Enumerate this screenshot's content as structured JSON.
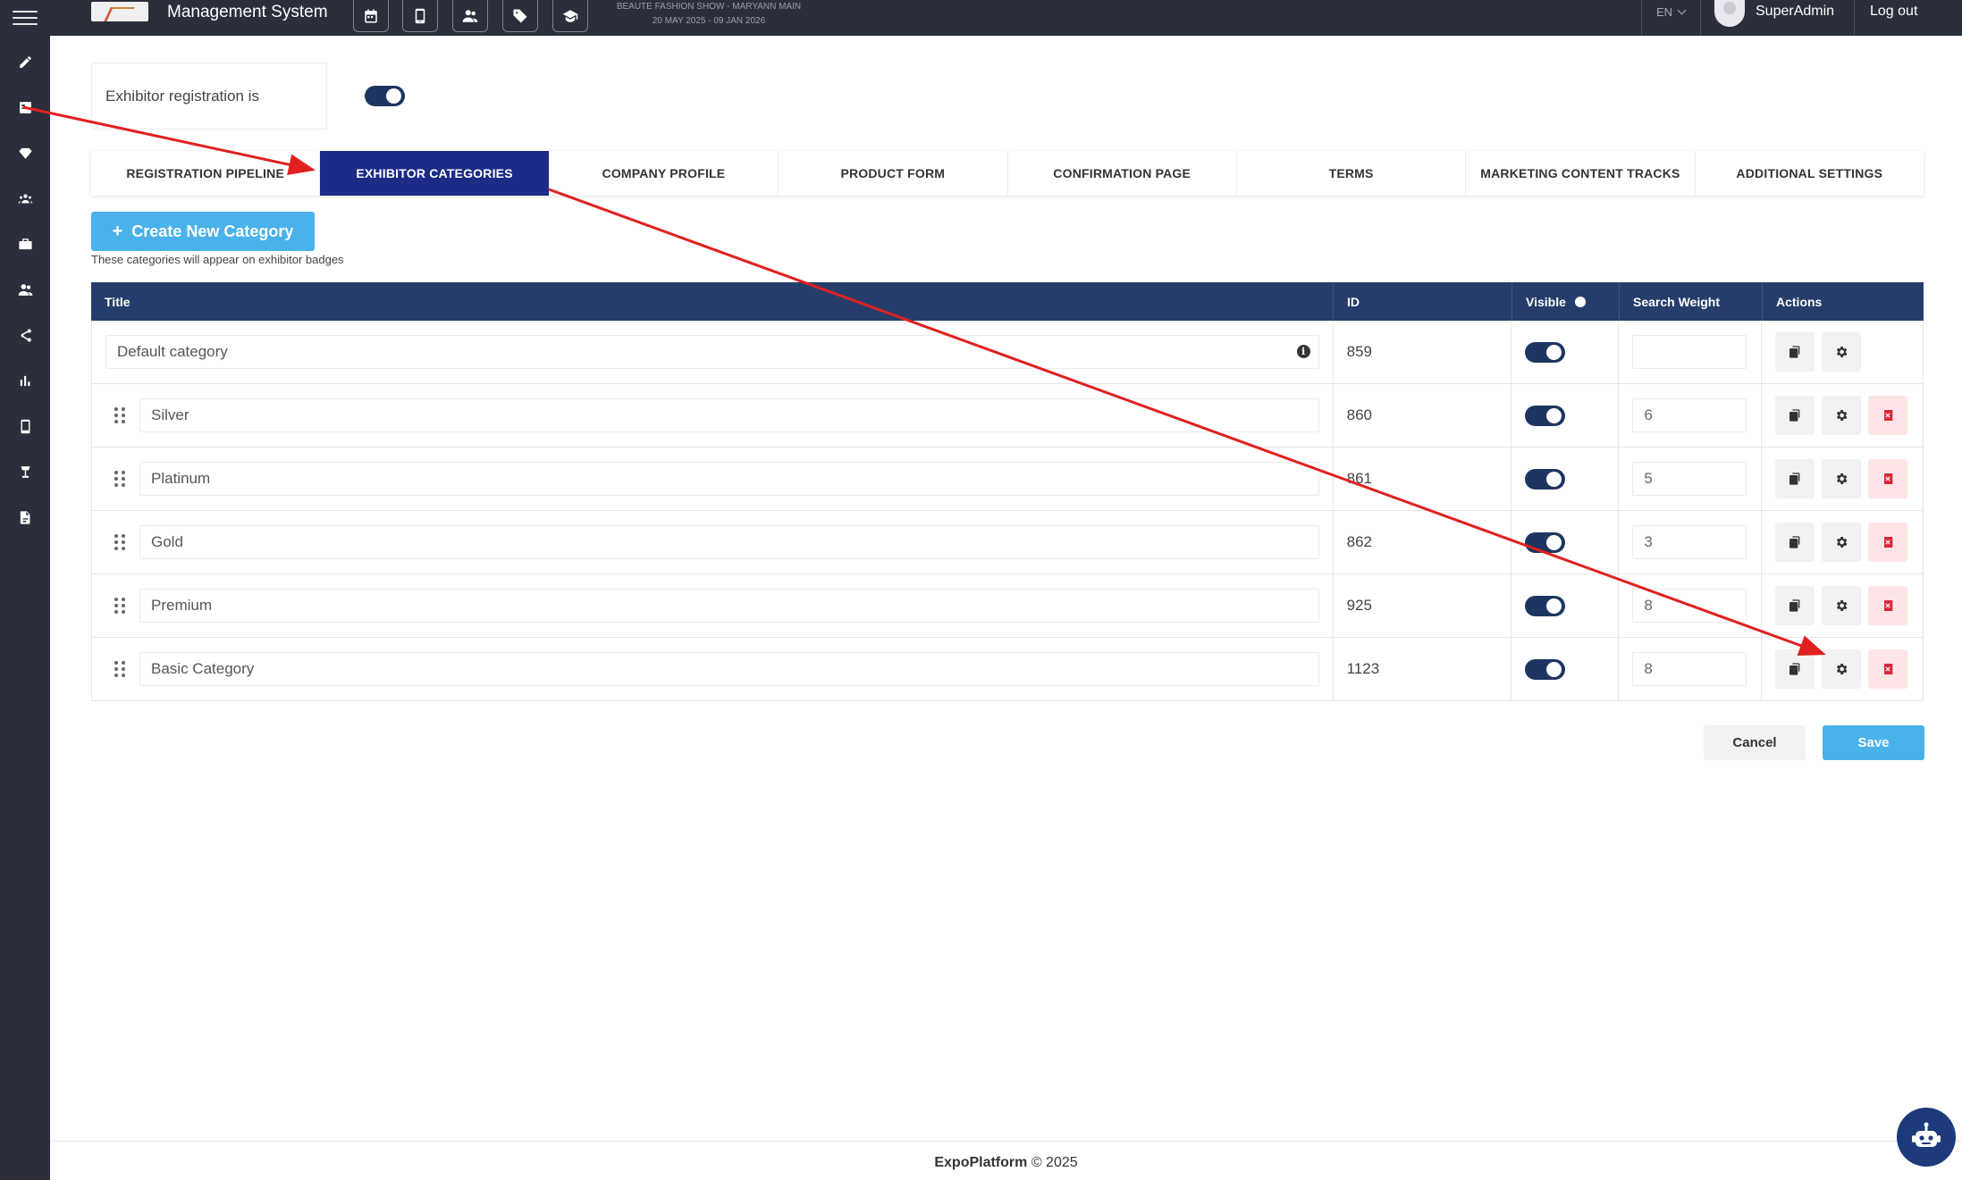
{
  "header": {
    "app_title": "Management System",
    "event_name": "BEAUTE FASHION SHOW - MARYANN MAIN",
    "event_dates": "20 MAY 2025 - 09 JAN 2026",
    "language": "EN",
    "user_name": "SuperAdmin",
    "logout_label": "Log out",
    "icons": [
      "calendar-icon",
      "mobile-icon",
      "people-icon",
      "tag-icon",
      "graduation-cap-icon"
    ]
  },
  "sidebar": {
    "items": [
      "pencil-icon",
      "form-icon",
      "diamond-icon",
      "group-icon",
      "briefcase-icon",
      "users-icon",
      "share-icon",
      "bar-chart-icon",
      "mobile-icon",
      "lamp-icon",
      "file-icon"
    ]
  },
  "registration": {
    "label": "Exhibitor registration is",
    "enabled": true
  },
  "tabs": [
    {
      "label": "REGISTRATION PIPELINE",
      "active": false
    },
    {
      "label": "EXHIBITOR CATEGORIES",
      "active": true
    },
    {
      "label": "COMPANY PROFILE",
      "active": false
    },
    {
      "label": "PRODUCT FORM",
      "active": false
    },
    {
      "label": "CONFIRMATION PAGE",
      "active": false
    },
    {
      "label": "TERMS",
      "active": false
    },
    {
      "label": "MARKETING CONTENT TRACKS",
      "active": false
    },
    {
      "label": "ADDITIONAL SETTINGS",
      "active": false
    }
  ],
  "create_button": {
    "plus": "+",
    "label": "Create New Category"
  },
  "hint": "These categories will appear on exhibitor badges",
  "table": {
    "headers": {
      "title": "Title",
      "id": "ID",
      "visible": "Visible",
      "weight": "Search Weight",
      "actions": "Actions"
    },
    "rows": [
      {
        "title": "Default category",
        "id": "859",
        "visible": true,
        "weight": "",
        "deletable": false,
        "draggable": false
      },
      {
        "title": "Silver",
        "id": "860",
        "visible": true,
        "weight": "6",
        "deletable": true,
        "draggable": true
      },
      {
        "title": "Platinum",
        "id": "861",
        "visible": true,
        "weight": "5",
        "deletable": true,
        "draggable": true
      },
      {
        "title": "Gold",
        "id": "862",
        "visible": true,
        "weight": "3",
        "deletable": true,
        "draggable": true
      },
      {
        "title": "Premium",
        "id": "925",
        "visible": true,
        "weight": "8",
        "deletable": true,
        "draggable": true
      },
      {
        "title": "Basic Category",
        "id": "1123",
        "visible": true,
        "weight": "8",
        "deletable": true,
        "draggable": true
      }
    ]
  },
  "buttons": {
    "cancel": "Cancel",
    "save": "Save"
  },
  "footer": {
    "brand": "ExpoPlatform",
    "copyright": "© 2025"
  },
  "colors": {
    "topbar": "#2b2e3b",
    "active_tab": "#1d2b87",
    "table_header": "#263d6c",
    "toggle_on": "#1d3560",
    "primary_button": "#4ab2ea",
    "delete": "#d9263a",
    "annotation_arrow": "#e02020"
  }
}
